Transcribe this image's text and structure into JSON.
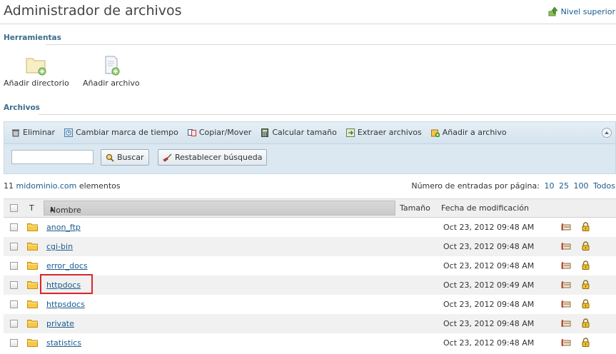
{
  "page_title": "Administrador de archivos",
  "up_level": "Nivel superior",
  "tools_section": "Herramientas",
  "tools": {
    "add_dir": "Añadir directorio",
    "add_file": "Añadir archivo"
  },
  "files_section": "Archivos",
  "actions": {
    "delete": "Eliminar",
    "timestamp": "Cambiar marca de tiempo",
    "copy_move": "Copiar/Mover",
    "calc_size": "Calcular tamaño",
    "extract": "Extraer archivos",
    "add_archive": "Añadir a archivo"
  },
  "search": {
    "value": "",
    "button": "Buscar",
    "reset": "Restablecer búsqueda"
  },
  "count": {
    "domain": "midominio.com",
    "suffix": "elementos",
    "number": "11"
  },
  "perpage": {
    "label": "Número de entradas por página:",
    "options": [
      "10",
      "25",
      "100",
      "Todos"
    ]
  },
  "columns": {
    "type": "T",
    "name": "Nombre",
    "sort_arrow": "▲",
    "size": "Tamaño",
    "modified": "Fecha de modificación"
  },
  "rows": [
    {
      "name": "anon_ftp",
      "modified": "Oct 23, 2012 09:48 AM"
    },
    {
      "name": "cgi-bin",
      "modified": "Oct 23, 2012 09:48 AM"
    },
    {
      "name": "error_docs",
      "modified": "Oct 23, 2012 09:48 AM"
    },
    {
      "name": "httpdocs",
      "modified": "Oct 23, 2012 09:49 AM"
    },
    {
      "name": "httpsdocs",
      "modified": "Oct 23, 2012 09:48 AM"
    },
    {
      "name": "private",
      "modified": "Oct 23, 2012 09:48 AM"
    },
    {
      "name": "statistics",
      "modified": "Oct 23, 2012 09:48 AM"
    }
  ],
  "colors": {
    "link": "#1a5b8f",
    "section": "#3b6c8c",
    "highlight": "#d9262b",
    "toolbar_bg": "#dbe8f1"
  }
}
